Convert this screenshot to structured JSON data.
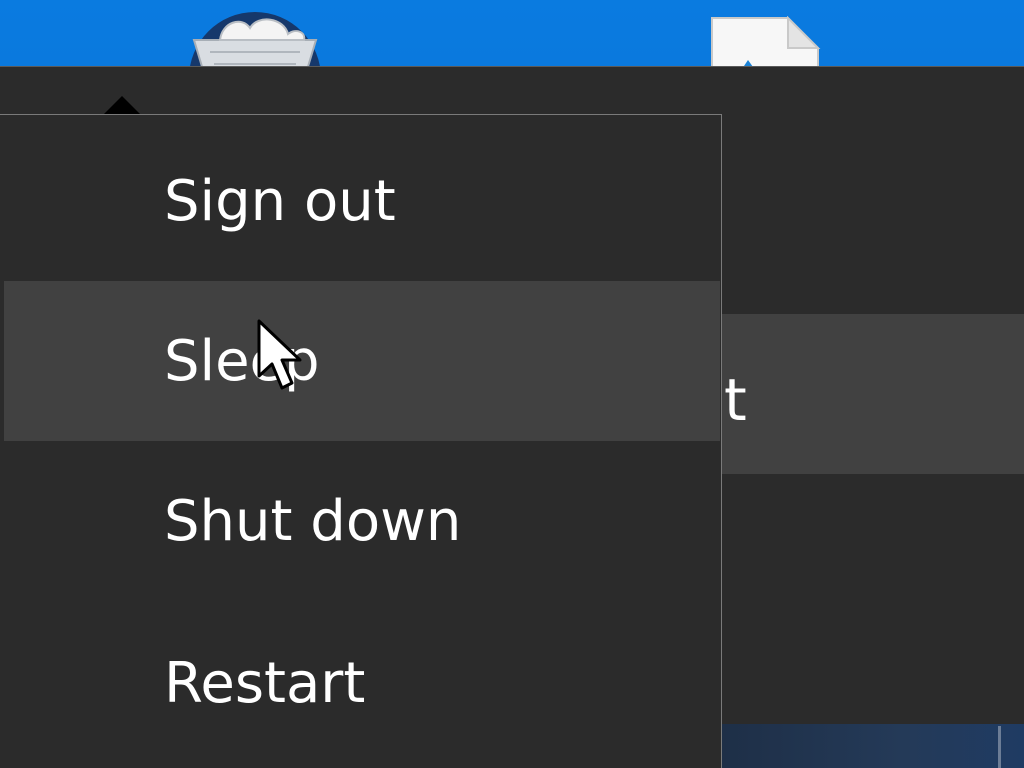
{
  "desktop": {
    "icons": [
      {
        "icon": "recycle-bin-icon"
      },
      {
        "icon": "file-icon"
      }
    ]
  },
  "background_panel": {
    "partial_label": "t"
  },
  "power_menu": {
    "items": [
      {
        "label": "Sign out",
        "state": "normal"
      },
      {
        "label": "Sleep",
        "state": "hover"
      },
      {
        "label": "Shut down",
        "state": "normal"
      },
      {
        "label": "Restart",
        "state": "normal"
      }
    ]
  },
  "colors": {
    "menu_background": "#2b2b2b",
    "hover_background": "#414141",
    "desktop_blue": "#0a7be0",
    "text": "#ffffff"
  },
  "pointer": {
    "icon": "mouse-pointer-icon"
  }
}
